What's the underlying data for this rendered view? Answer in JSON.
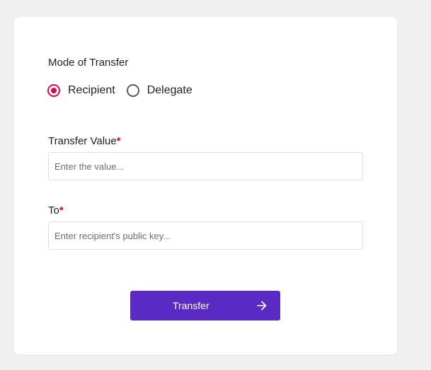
{
  "form": {
    "mode_label": "Mode of Transfer",
    "mode_options": [
      {
        "label": "Recipient",
        "selected": true
      },
      {
        "label": "Delegate",
        "selected": false
      }
    ],
    "value_label": "Transfer Value",
    "value_required_mark": "*",
    "value_placeholder": "Enter the value...",
    "value_input": "",
    "to_label": "To",
    "to_required_mark": "*",
    "to_placeholder": "Enter recipient's public key...",
    "to_input": "",
    "submit_label": "Transfer",
    "submit_icon": "arrow-right-icon"
  },
  "colors": {
    "page_background": "#f0f0f0",
    "card_background": "#ffffff",
    "radio_accent": "#e0094f",
    "required_mark": "#e0002a",
    "button_background": "#5b2ac4",
    "button_text": "#ffffff"
  }
}
